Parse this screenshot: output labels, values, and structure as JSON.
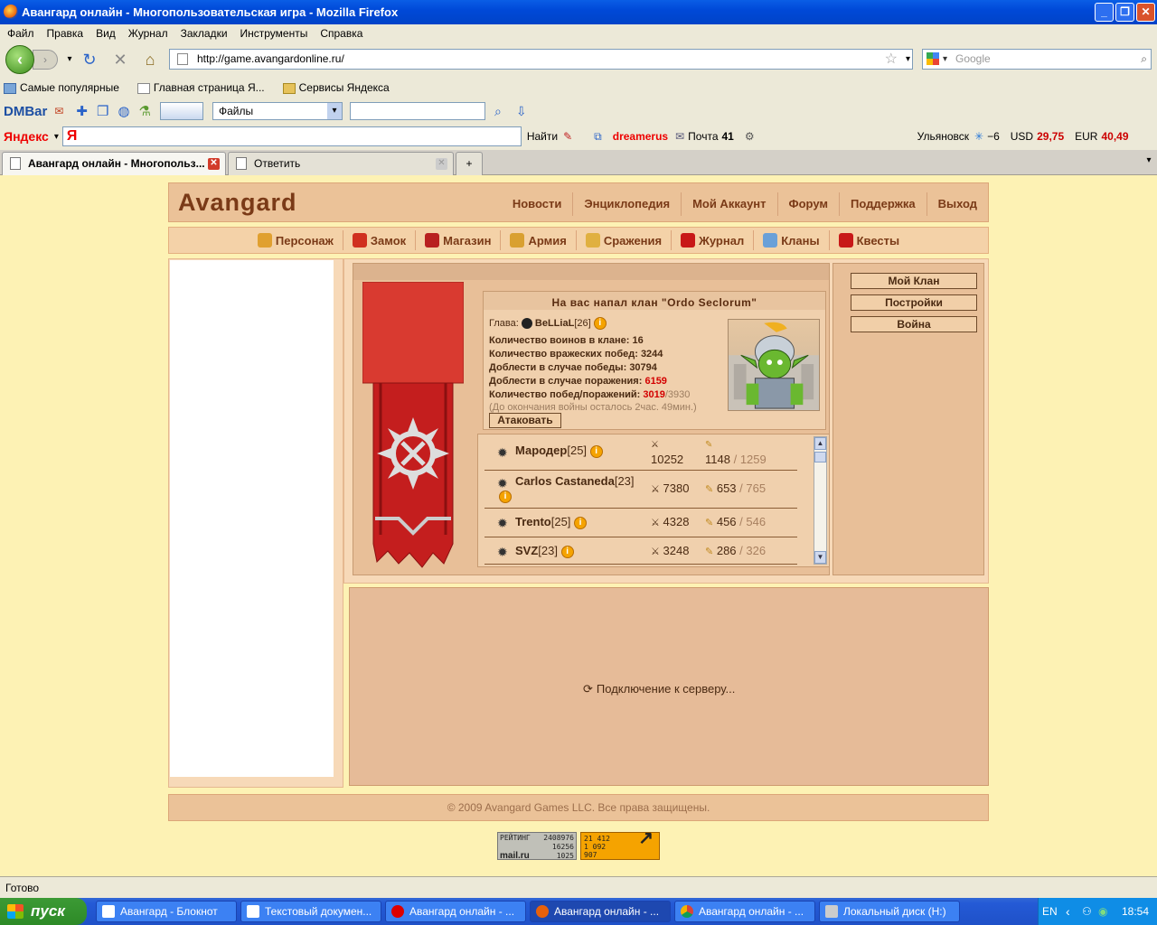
{
  "window": {
    "title": "Авангард онлайн - Многопользовательская игра - Mozilla Firefox"
  },
  "menu": [
    "Файл",
    "Правка",
    "Вид",
    "Журнал",
    "Закладки",
    "Инструменты",
    "Справка"
  ],
  "nav": {
    "url": "http://game.avangardonline.ru/",
    "search_placeholder": "Google"
  },
  "bookmarks": [
    "Самые популярные",
    "Главная страница Я...",
    "Сервисы Яндекса"
  ],
  "dmbar": {
    "logo": "DMBar",
    "combo": "Файлы"
  },
  "yandex": {
    "logo": "Яндекс",
    "input": "Я",
    "find": "Найти",
    "user": "dreamerus",
    "mail": "Почта",
    "mail_count": "41",
    "city": "Ульяновск",
    "temp": "−6",
    "usd_label": "USD",
    "usd": "29,75",
    "eur_label": "EUR",
    "eur": "40,49"
  },
  "tabs": [
    {
      "label": "Авангард онлайн - Многопольз..."
    },
    {
      "label": "Ответить"
    }
  ],
  "site": {
    "brand": "Avangard",
    "topnav": [
      "Новости",
      "Энциклопедия",
      "Мой Аккаунт",
      "Форум",
      "Поддержка",
      "Выход"
    ],
    "gamenav": [
      "Персонаж",
      "Замок",
      "Магазин",
      "Армия",
      "Сражения",
      "Журнал",
      "Кланы",
      "Квесты"
    ],
    "attack": {
      "title": "На вас напал клан \"Ordo Seclorum\"",
      "head_label": "Глава:",
      "head_name": "BeLLiaL",
      "head_level": "[26]",
      "warriors_label": "Количество воинов в клане:",
      "warriors": "16",
      "enemy_wins_label": "Количество вражеских побед:",
      "enemy_wins": "3244",
      "valor_win_label": "Доблести в случае победы:",
      "valor_win": "30794",
      "valor_lose_label": "Доблести в случае поражения:",
      "valor_lose": "6159",
      "winloss_label": "Количество побед/поражений:",
      "wins": "3019",
      "losses": "/3930",
      "timer": "(До окончания войны осталось 2час. 49мин.)",
      "button": "Атаковать"
    },
    "members": [
      {
        "name": "Мародер",
        "level": "[25]",
        "kills": "10252",
        "s1": "1148",
        "s2": "/ 1259"
      },
      {
        "name": "Carlos Castaneda",
        "level": "[23]",
        "kills": "7380",
        "s1": "653",
        "s2": "/ 765"
      },
      {
        "name": "Trento",
        "level": "[25]",
        "kills": "4328",
        "s1": "456",
        "s2": "/ 546"
      },
      {
        "name": "SVZ",
        "level": "[23]",
        "kills": "3248",
        "s1": "286",
        "s2": "/ 326"
      }
    ],
    "side_buttons": [
      "Мой Клан",
      "Постройки",
      "Война"
    ],
    "loading": "Подключение к серверу...",
    "footer": "© 2009 Avangard Games LLC. Все права защищены.",
    "counter1": [
      "РЕЙТИНГ",
      "2408976",
      "16256",
      "1025",
      "mail.ru"
    ],
    "counter2": [
      "21 412",
      "1 092",
      "907"
    ]
  },
  "status": "Готово",
  "taskbar": {
    "start": "пуск",
    "tasks": [
      "Авангард - Блокнот",
      "Текстовый докумен...",
      "Авангард онлайн - ...",
      "Авангард онлайн - ...",
      "Авангард онлайн - ...",
      "Локальный диск (H:)"
    ],
    "lang": "EN",
    "clock": "18:54"
  }
}
